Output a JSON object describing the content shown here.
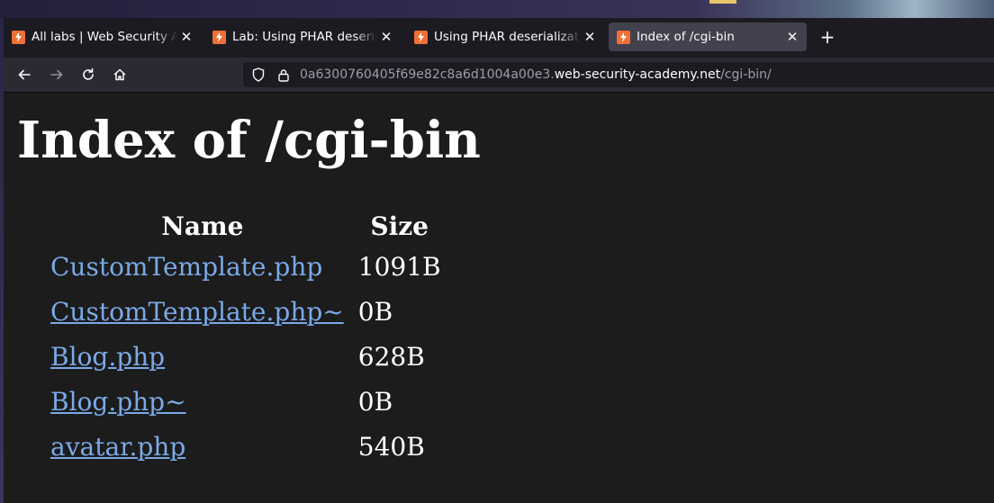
{
  "browser": {
    "tabs": [
      {
        "label": "All labs | Web Security Academy",
        "active": false
      },
      {
        "label": "Lab: Using PHAR deserialization to deploy a custom gadget chain",
        "active": false
      },
      {
        "label": "Using PHAR deserialization to deploy a custom gadget chain",
        "active": false
      },
      {
        "label": "Index of /cgi-bin",
        "active": true
      }
    ],
    "new_tab": "+",
    "url_prefix": "0a6300760405f69e82c8a6d1004a00e3.",
    "url_host": "web-security-academy.net",
    "url_path": "/cgi-bin/",
    "colors": {
      "favicon": "#f06f36",
      "active_tab": "#42414d",
      "link": "#7aa9e6"
    }
  },
  "page": {
    "title": "Index of /cgi-bin",
    "headers": {
      "name": "Name",
      "size": "Size"
    },
    "files": [
      {
        "name": "CustomTemplate.php",
        "size": "1091B",
        "underlined": false
      },
      {
        "name": "CustomTemplate.php~",
        "size": "0B",
        "underlined": true
      },
      {
        "name": "Blog.php",
        "size": "628B",
        "underlined": true
      },
      {
        "name": "Blog.php~",
        "size": "0B",
        "underlined": true
      },
      {
        "name": "avatar.php",
        "size": "540B",
        "underlined": true
      }
    ]
  }
}
